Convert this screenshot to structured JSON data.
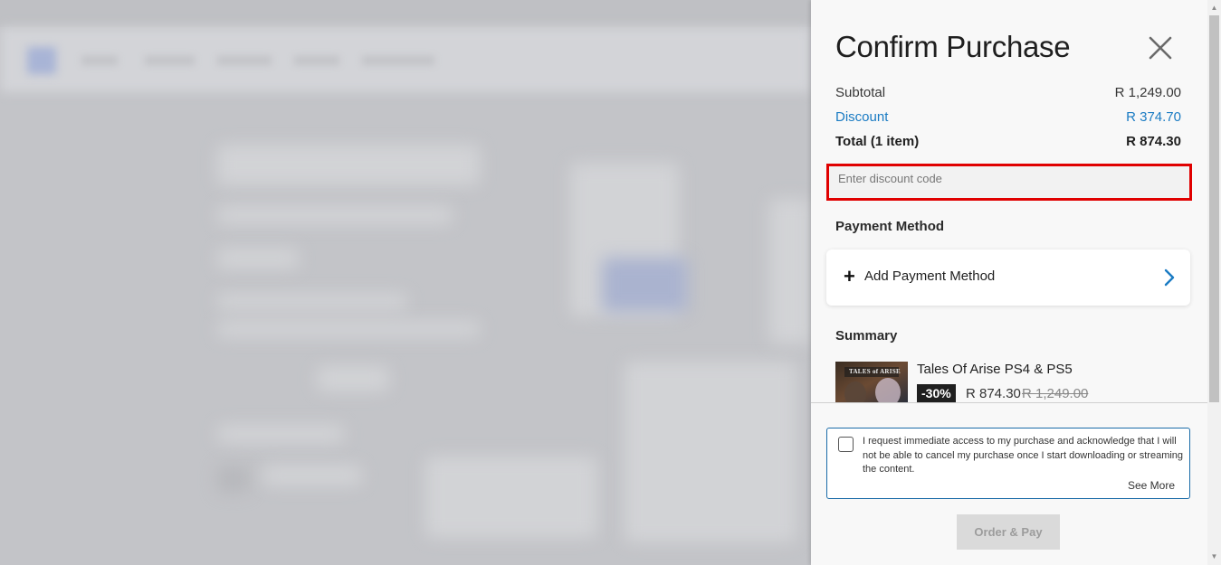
{
  "drawer": {
    "title": "Confirm Purchase",
    "close_icon": "close-icon",
    "subtotal": {
      "label": "Subtotal",
      "value": "R 1,249.00"
    },
    "discount": {
      "label": "Discount",
      "value": "R 374.70"
    },
    "total": {
      "label": "Total (1 item)",
      "value": "R 874.30"
    },
    "discount_code": {
      "placeholder": "Enter discount code",
      "value": ""
    },
    "payment_method": {
      "heading": "Payment Method",
      "add_label": "Add Payment Method",
      "plus_icon": "plus-icon",
      "chevron_icon": "chevron-right-icon"
    },
    "summary": {
      "heading": "Summary",
      "item": {
        "name": "Tales Of Arise PS4 & PS5",
        "discount_badge": "-30%",
        "price": "R 874.30",
        "original_price": "R 1,249.00",
        "thumb_text": "TALES of ARISE"
      }
    },
    "consent": {
      "text": "I request immediate access to my purchase and acknowledge that I will not be able to cancel my purchase once I start downloading or streaming the content.",
      "see_more": "See More",
      "checked": false
    },
    "order_button": "Order & Pay"
  },
  "colors": {
    "accent_link": "#1a7bc3",
    "highlight_border": "#e00000",
    "drawer_bg": "#f8f8f8",
    "overlay_bg": "#c3c4c8"
  }
}
